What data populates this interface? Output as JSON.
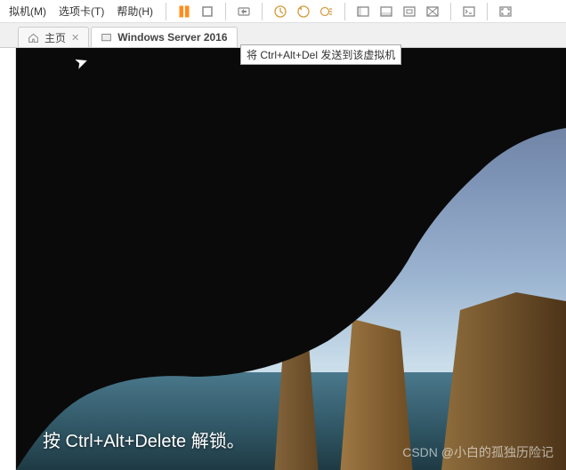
{
  "menu": {
    "vm": "拟机(M)",
    "tabs": "选项卡(T)",
    "help": "帮助(H)"
  },
  "toolbar": {
    "pause": "pause",
    "stop": "stop",
    "send_keys": "send-ctrl-alt-del",
    "tooltip": "将 Ctrl+Alt+Del 发送到该虚拟机"
  },
  "tabs": {
    "home": "主页",
    "vm_name": "Windows Server 2016"
  },
  "lock_screen": {
    "unlock_msg": "按 Ctrl+Alt+Delete 解锁。"
  },
  "watermark": "CSDN @小白的孤独历险记"
}
